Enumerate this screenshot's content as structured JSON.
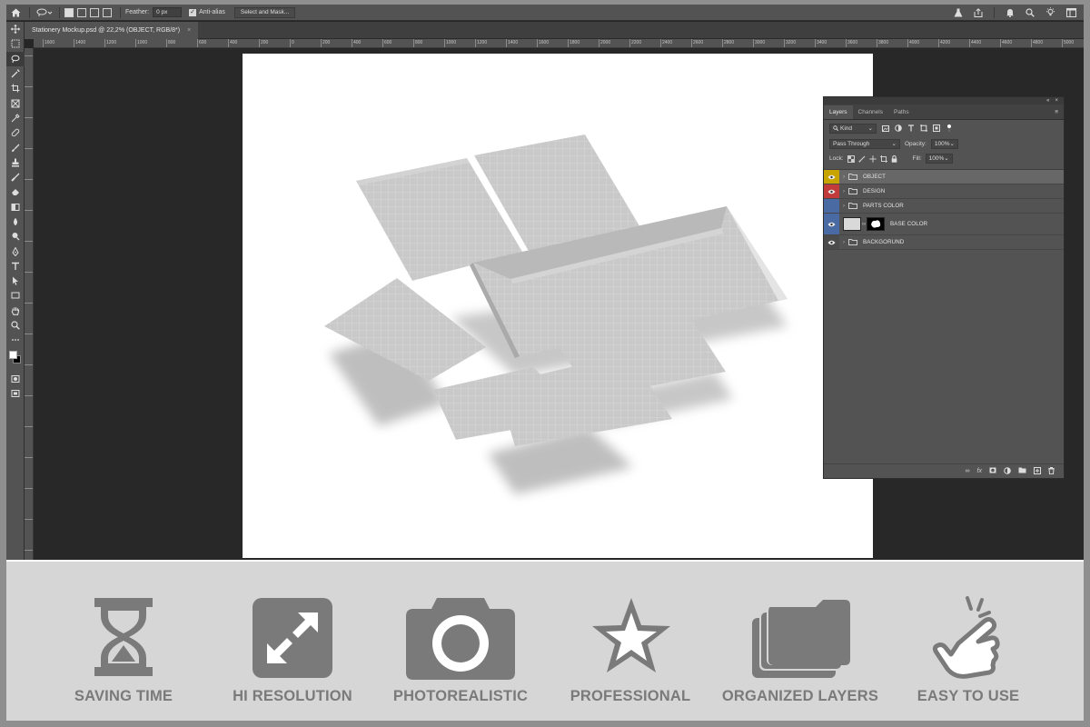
{
  "options_bar": {
    "feather_label": "Feather:",
    "feather_value": "0 px",
    "antialias_label": "Anti-alias",
    "select_mask_label": "Select and Mask..."
  },
  "document_tab": {
    "title": "Stationery Mockup.psd @ 22,2% (OBJECT, RGB/8*)",
    "close": "×"
  },
  "ruler": {
    "h_ticks": [
      "1600",
      "1400",
      "1200",
      "1000",
      "800",
      "600",
      "400",
      "200",
      "0",
      "200",
      "400",
      "600",
      "800",
      "1000",
      "1200",
      "1400",
      "1600",
      "1800",
      "2000",
      "2200",
      "2400",
      "2600",
      "2800",
      "3000",
      "3200",
      "3400",
      "3600",
      "3800",
      "4000",
      "4200",
      "4400",
      "4600",
      "4800",
      "5000"
    ]
  },
  "layers_panel": {
    "tabs": [
      {
        "label": "Layers",
        "active": true
      },
      {
        "label": "Channels",
        "active": false
      },
      {
        "label": "Paths",
        "active": false
      }
    ],
    "filter_kind": "Kind",
    "blend_mode": "Pass Through",
    "opacity_label": "Opacity:",
    "opacity_value": "100%",
    "lock_label": "Lock:",
    "fill_label": "Fill:",
    "fill_value": "100%",
    "layers": [
      {
        "name": "OBJECT",
        "color": "#c8a400",
        "type": "group",
        "selected": true
      },
      {
        "name": "DESIGN",
        "color": "#c23a3a",
        "type": "group",
        "selected": false
      },
      {
        "name": "PARTS COLOR",
        "color": "#4a6aa3",
        "type": "group",
        "selected": false
      },
      {
        "name": "BASE COLOR",
        "color": "#4a6aa3",
        "type": "smart",
        "selected": false
      },
      {
        "name": "BACKGORUND",
        "color": "#4b4b4b",
        "type": "group",
        "selected": false
      }
    ]
  },
  "features": [
    {
      "label": "SAVING TIME",
      "icon": "hourglass-icon"
    },
    {
      "label": "HI RESOLUTION",
      "icon": "expand-arrows-icon"
    },
    {
      "label": "PHOTOREALISTIC",
      "icon": "camera-icon"
    },
    {
      "label": "PROFESSIONAL",
      "icon": "star-icon"
    },
    {
      "label": "ORGANIZED LAYERS",
      "icon": "stacked-folders-icon"
    },
    {
      "label": "EASY TO USE",
      "icon": "pointing-hand-icon"
    }
  ],
  "colors": {
    "icon_gray": "#7a7a7a",
    "strip_bg": "#d6d6d6",
    "ps_panel": "#535353",
    "ps_canvas": "#282828"
  }
}
